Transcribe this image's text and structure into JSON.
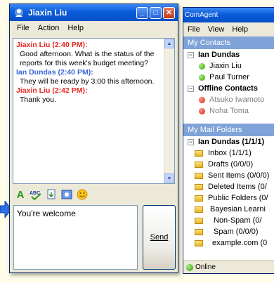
{
  "chat_window": {
    "title": "Jiaxin Liu",
    "menu": [
      "File",
      "Action",
      "Help"
    ],
    "messages": [
      {
        "sender": "Jiaxin Liu (2:40 PM):",
        "text": "Good afternoon. What is the status of the reports for this week's budget meeting?",
        "color": "#e8281c"
      },
      {
        "sender": "Ian Dundas (2:40 PM):",
        "text": "They will be ready by 3:00 this afternoon.",
        "color": "#3a66d8"
      },
      {
        "sender": "Jiaxin Liu (2:42 PM):",
        "text": "Thank you.",
        "color": "#e8281c"
      }
    ],
    "input_value": "You're welcome",
    "send_label": "Send",
    "toolbar_icons": [
      "font-icon",
      "spell-check-icon",
      "file-transfer-icon",
      "image-icon",
      "emoticon-icon"
    ]
  },
  "com_window": {
    "title": "ComAgent",
    "menu": [
      "File",
      "View",
      "Help"
    ],
    "contacts_header": "My Contacts",
    "contacts": {
      "online_group": "Ian Dundas",
      "online": [
        "Jiaxin Liu",
        "Paul Turner"
      ],
      "offline_group": "Offline Contacts",
      "offline": [
        "Atsuko Iwamoto",
        "Noha Toma"
      ]
    },
    "folders_header": "My Mail Folders",
    "folder_root": "Ian Dundas (1/1/1)",
    "folders": [
      "Inbox (1/1/1)",
      "Drafts (0/0/0)",
      "Sent Items (0/0/0)",
      "Deleted Items (0/",
      "Public Folders (0/",
      "Bayesian Learni",
      "Non-Spam (0/",
      "Spam (0/0/0)",
      "example.com (0"
    ],
    "status": "Online"
  },
  "colors": {
    "sender_red": "#e8281c",
    "sender_blue": "#3a66d8",
    "titlebar": "#0a5cd8",
    "panel_header": "#7fa3d8"
  }
}
